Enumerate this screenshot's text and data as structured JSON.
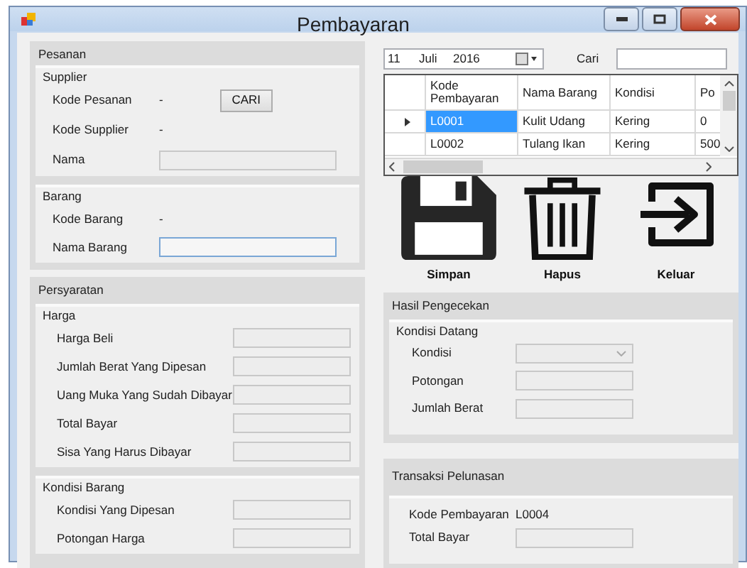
{
  "window": {
    "title": "Pembayaran"
  },
  "pesanan": {
    "title": "Pesanan",
    "groups": [
      {
        "title": "Supplier",
        "fields": [
          {
            "kind": "text",
            "label": "Kode Pesanan",
            "value": "-",
            "button": "CARI"
          },
          {
            "kind": "text",
            "label": "Kode Supplier",
            "value": "-"
          },
          {
            "kind": "input",
            "label": "Nama",
            "disabled": true
          }
        ]
      },
      {
        "title": "Barang",
        "fields": [
          {
            "kind": "text",
            "label": "Kode Barang",
            "value": "-"
          },
          {
            "kind": "input",
            "label": "Nama Barang",
            "disabled": false
          }
        ]
      }
    ]
  },
  "persyaratan": {
    "title": "Persyaratan",
    "groups": [
      {
        "title": "Harga",
        "fields": [
          {
            "kind": "input",
            "label": "Harga Beli",
            "disabled": true
          },
          {
            "kind": "input",
            "label": "Jumlah Berat Yang Dipesan",
            "disabled": true
          },
          {
            "kind": "input",
            "label": "Uang Muka Yang Sudah Dibayar",
            "disabled": true
          },
          {
            "kind": "input",
            "label": "Total Bayar",
            "disabled": true
          },
          {
            "kind": "input",
            "label": "Sisa Yang Harus Dibayar",
            "disabled": true
          }
        ]
      },
      {
        "title": "Kondisi Barang",
        "fields": [
          {
            "kind": "input",
            "label": "Kondisi Yang Dipesan",
            "disabled": true
          },
          {
            "kind": "input",
            "label": "Potongan Harga",
            "disabled": true
          }
        ]
      }
    ]
  },
  "date_picker": {
    "day": "11",
    "month": "Juli",
    "year": "2016"
  },
  "search": {
    "label": "Cari"
  },
  "grid": {
    "columns": [
      "Kode Pembayaran",
      "Nama Barang",
      "Kondisi",
      "Po"
    ],
    "rows": [
      {
        "selected": true,
        "cells": [
          "L0001",
          "Kulit Udang",
          "Kering",
          "0"
        ]
      },
      {
        "selected": false,
        "cells": [
          "L0002",
          "Tulang Ikan",
          "Kering",
          "500"
        ]
      }
    ]
  },
  "actions": [
    {
      "kind": "save",
      "label": "Simpan"
    },
    {
      "kind": "delete",
      "label": "Hapus"
    },
    {
      "kind": "exit",
      "label": "Keluar"
    }
  ],
  "hasil": {
    "title": "Hasil Pengecekan",
    "groups": [
      {
        "title": "Kondisi Datang",
        "fields": [
          {
            "kind": "combo",
            "label": "Kondisi",
            "disabled": true
          },
          {
            "kind": "input",
            "label": "Potongan",
            "disabled": true
          },
          {
            "kind": "input",
            "label": "Jumlah Berat",
            "disabled": true
          }
        ]
      }
    ]
  },
  "transaksi": {
    "title": "Transaksi Pelunasan",
    "groups": [
      {
        "fields": [
          {
            "kind": "text",
            "label": "Kode Pembayaran",
            "value": "L0004"
          },
          {
            "kind": "input",
            "label": "Total Bayar",
            "disabled": true
          }
        ]
      }
    ]
  }
}
